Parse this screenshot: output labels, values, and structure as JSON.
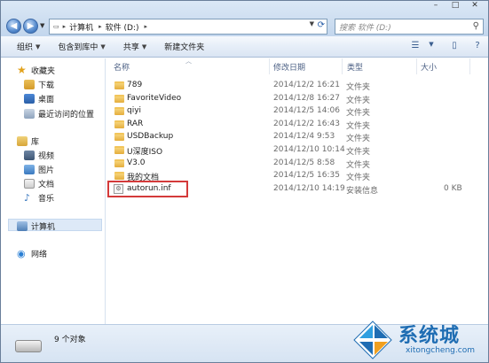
{
  "address": {
    "segments": [
      "计算机",
      "软件 (D:)"
    ]
  },
  "search": {
    "placeholder": "搜索 软件 (D:)"
  },
  "toolbar": {
    "organize": "组织",
    "include_in_library": "包含到库中",
    "share": "共享",
    "new_folder": "新建文件夹"
  },
  "nav": {
    "favorites": "收藏夹",
    "downloads": "下载",
    "desktop": "桌面",
    "recent": "最近访问的位置",
    "libraries": "库",
    "videos": "视频",
    "pictures": "图片",
    "documents": "文档",
    "music": "音乐",
    "computer": "计算机",
    "network": "网络"
  },
  "columns": {
    "name": "名称",
    "modified": "修改日期",
    "type": "类型",
    "size": "大小"
  },
  "files": [
    {
      "name": "789",
      "modified": "2014/12/2 16:21",
      "type": "文件夹",
      "size": "",
      "kind": "folder"
    },
    {
      "name": "FavoriteVideo",
      "modified": "2014/12/8 16:27",
      "type": "文件夹",
      "size": "",
      "kind": "folder"
    },
    {
      "name": "qiyi",
      "modified": "2014/12/5 14:06",
      "type": "文件夹",
      "size": "",
      "kind": "folder"
    },
    {
      "name": "RAR",
      "modified": "2014/12/2 16:43",
      "type": "文件夹",
      "size": "",
      "kind": "folder"
    },
    {
      "name": "USDBackup",
      "modified": "2014/12/4 9:53",
      "type": "文件夹",
      "size": "",
      "kind": "folder"
    },
    {
      "name": "U深度ISO",
      "modified": "2014/12/10 10:14",
      "type": "文件夹",
      "size": "",
      "kind": "folder"
    },
    {
      "name": "V3.0",
      "modified": "2014/12/5 8:58",
      "type": "文件夹",
      "size": "",
      "kind": "folder"
    },
    {
      "name": "我的文档",
      "modified": "2014/12/5 16:35",
      "type": "文件夹",
      "size": "",
      "kind": "folder"
    },
    {
      "name": "autorun.inf",
      "modified": "2014/12/10 14:19",
      "type": "安装信息",
      "size": "0 KB",
      "kind": "file"
    }
  ],
  "status": {
    "count_text": "9 个对象"
  },
  "watermark": {
    "cn": "系统城",
    "en": "xitongcheng.com"
  },
  "colors": {
    "accent": "#1f6db3",
    "highlight": "#d43a3a",
    "folder": "#e4ad3c"
  }
}
